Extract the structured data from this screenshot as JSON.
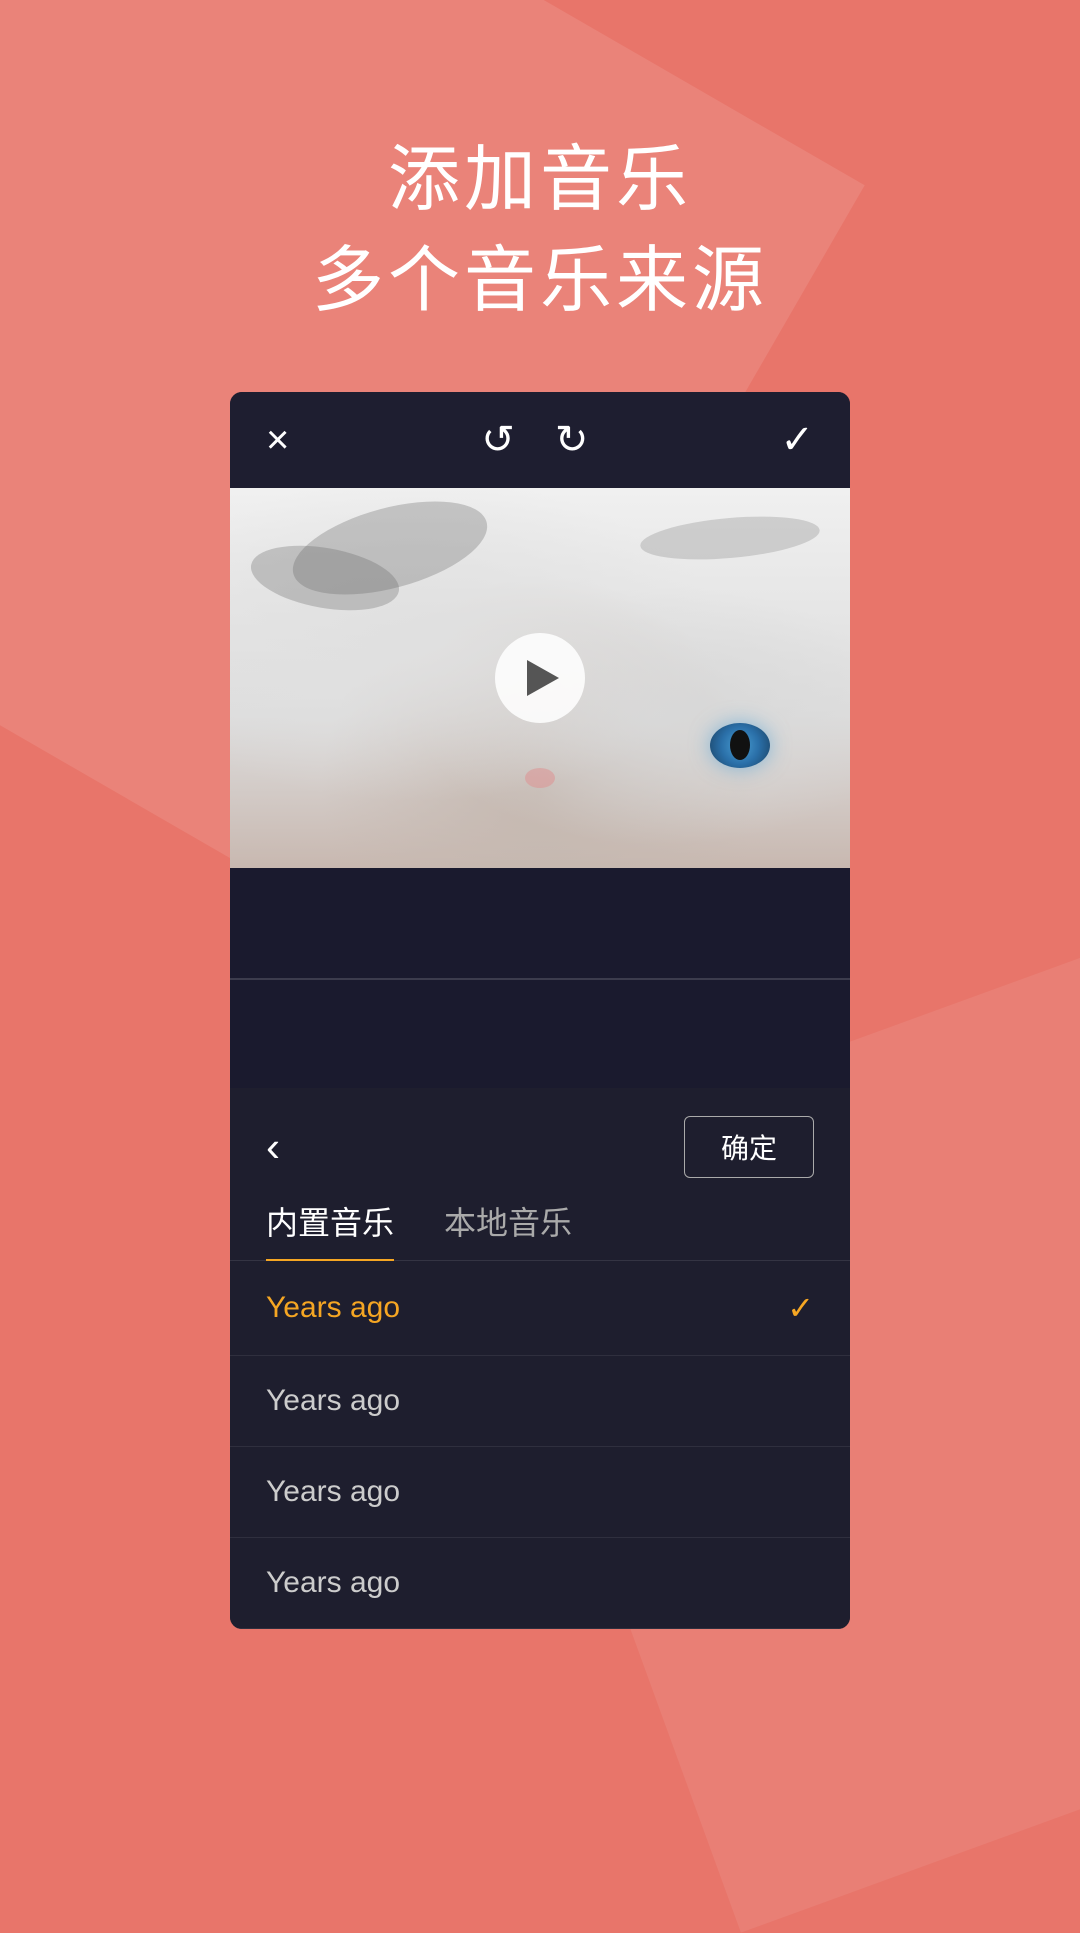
{
  "page": {
    "background_color": "#e8756a",
    "header": {
      "line1": "添加音乐",
      "line2": "多个音乐来源"
    },
    "toolbar": {
      "close_label": "×",
      "undo_label": "↺",
      "redo_label": "↻",
      "confirm_label": "✓"
    },
    "video": {
      "play_button_visible": true
    },
    "music_panel": {
      "back_label": "‹",
      "confirm_button_label": "确定",
      "tabs": [
        {
          "id": "builtin",
          "label": "内置音乐",
          "active": true
        },
        {
          "id": "local",
          "label": "本地音乐",
          "active": false
        }
      ],
      "music_items": [
        {
          "id": 1,
          "title": "Years ago",
          "active": true,
          "checked": true
        },
        {
          "id": 2,
          "title": "Years ago",
          "active": false,
          "checked": false
        },
        {
          "id": 3,
          "title": "Years ago",
          "active": false,
          "checked": false
        },
        {
          "id": 4,
          "title": "Years ago",
          "active": false,
          "checked": false
        }
      ]
    }
  }
}
